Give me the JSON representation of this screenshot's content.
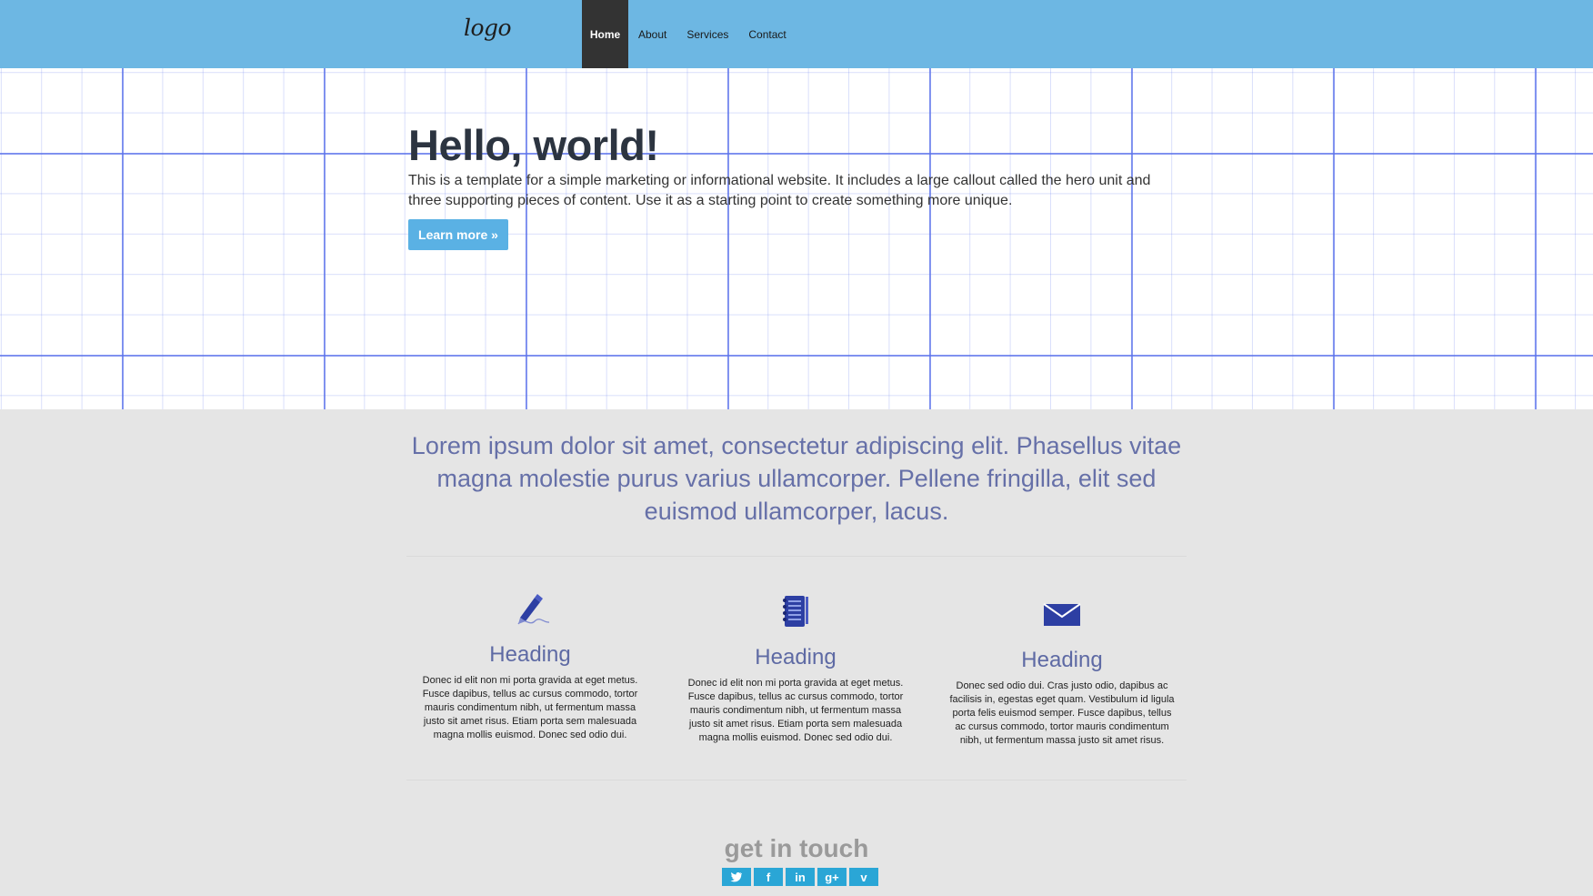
{
  "navbar": {
    "logo": "logo",
    "items": [
      {
        "label": "Home",
        "active": true
      },
      {
        "label": "About",
        "active": false
      },
      {
        "label": "Services",
        "active": false
      },
      {
        "label": "Contact",
        "active": false
      }
    ]
  },
  "hero": {
    "title": "Hello, world!",
    "text": "This is a template for a simple marketing or informational website. It includes a large callout called the hero unit and three supporting pieces of content. Use it as a starting point to create something more unique.",
    "button": "Learn more »"
  },
  "lead": "Lorem ipsum dolor sit amet, consectetur adipiscing elit. Phasellus vitae magna molestie purus varius ullamcorper. Pellene fringilla, elit sed euismod ullamcorper, lacus.",
  "features": [
    {
      "icon": "pen-icon",
      "heading": "Heading",
      "text": "Donec id elit non mi porta gravida at eget metus. Fusce dapibus, tellus ac cursus commodo, tortor mauris condimentum nibh, ut fermentum massa justo sit amet risus. Etiam porta sem malesuada magna mollis euismod. Donec sed odio dui."
    },
    {
      "icon": "notebook-icon",
      "heading": "Heading",
      "text": "Donec id elit non mi porta gravida at eget metus. Fusce dapibus, tellus ac cursus commodo, tortor mauris condimentum nibh, ut fermentum massa justo sit amet risus. Etiam porta sem malesuada magna mollis euismod. Donec sed odio dui."
    },
    {
      "icon": "envelope-icon",
      "heading": "Heading",
      "text": "Donec sed odio dui. Cras justo odio, dapibus ac facilisis in, egestas eget quam. Vestibulum id ligula porta felis euismod semper. Fusce dapibus, tellus ac cursus commodo, tortor mauris condimentum nibh, ut fermentum massa justo sit amet risus."
    }
  ],
  "footer": {
    "title": "get in touch",
    "social": [
      {
        "icon": "twitter-icon",
        "glyph": "🐦"
      },
      {
        "icon": "facebook-icon",
        "glyph": "f"
      },
      {
        "icon": "linkedin-icon",
        "glyph": "in"
      },
      {
        "icon": "googleplus-icon",
        "glyph": "g+"
      },
      {
        "icon": "vimeo-icon",
        "glyph": "v"
      }
    ]
  },
  "colors": {
    "navbar": "#6db7e3",
    "nav_active": "#333333",
    "button": "#5ab1e4",
    "grid": "#5c73eb",
    "lead_text": "#6670a8",
    "social": "#2aa6d6",
    "background": "#e5e5e5"
  }
}
